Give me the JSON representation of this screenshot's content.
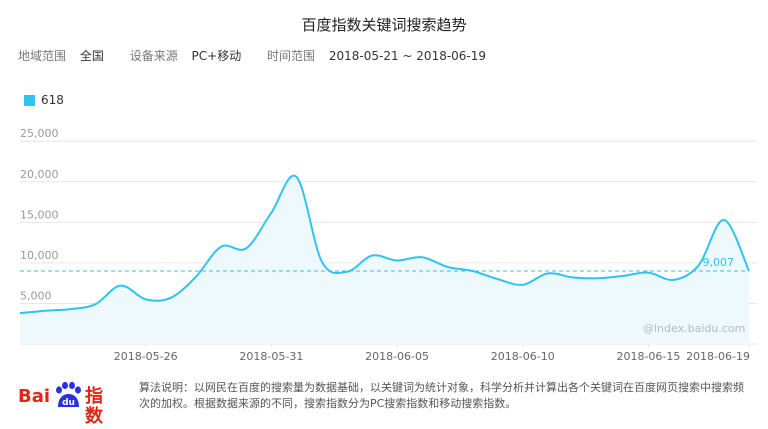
{
  "title": "百度指数关键词搜索趋势",
  "filters": {
    "region_label": "地域范围",
    "region_value": "全国",
    "device_label": "设备来源",
    "device_value": "PC+移动",
    "time_label": "时间范围",
    "time_value": "2018-05-21 ~ 2018-06-19"
  },
  "legend": {
    "series_name": "618"
  },
  "watermark": "@index.baidu.com",
  "logo": {
    "brand_text": "Bai",
    "paw_text": "du",
    "suffix_text": "指数"
  },
  "description": "算法说明：以网民在百度的搜索量为数据基础，以关键词为统计对象，科学分析并计算出各个关键词在百度网页搜索中搜索频次的加权。根据数据来源的不同，搜索指数分为PC搜索指数和移动搜索指数。",
  "colors": {
    "line": "#2fc3f0",
    "area": "#eef9fd",
    "axis_text": "#999999",
    "grid": "#e6e6e6",
    "average": "#2fc3f0"
  },
  "chart_data": {
    "type": "area",
    "series": [
      {
        "name": "618",
        "x": [
          "2018-05-21",
          "2018-05-22",
          "2018-05-23",
          "2018-05-24",
          "2018-05-25",
          "2018-05-26",
          "2018-05-27",
          "2018-05-28",
          "2018-05-29",
          "2018-05-30",
          "2018-05-31",
          "2018-06-01",
          "2018-06-02",
          "2018-06-03",
          "2018-06-04",
          "2018-06-05",
          "2018-06-06",
          "2018-06-07",
          "2018-06-08",
          "2018-06-09",
          "2018-06-10",
          "2018-06-11",
          "2018-06-12",
          "2018-06-13",
          "2018-06-14",
          "2018-06-15",
          "2018-06-16",
          "2018-06-17",
          "2018-06-18",
          "2018-06-19"
        ],
        "values": [
          3800,
          4100,
          4300,
          4900,
          7200,
          5500,
          5700,
          8300,
          12000,
          11800,
          16200,
          20600,
          10200,
          8900,
          10900,
          10300,
          10700,
          9500,
          9000,
          8000,
          7300,
          8700,
          8200,
          8100,
          8400,
          8800,
          7900,
          9700,
          15300,
          9007
        ]
      }
    ],
    "x_tick_labels": [
      "2018-05-26",
      "2018-05-31",
      "2018-06-05",
      "2018-06-10",
      "2018-06-15",
      "2018-06-19"
    ],
    "y_tick_labels": [
      "5,000",
      "10,000",
      "15,000",
      "20,000",
      "25,000"
    ],
    "ylim": [
      0,
      27000
    ],
    "average_label": "9,007",
    "grid": true,
    "legend_position": "top-left"
  }
}
